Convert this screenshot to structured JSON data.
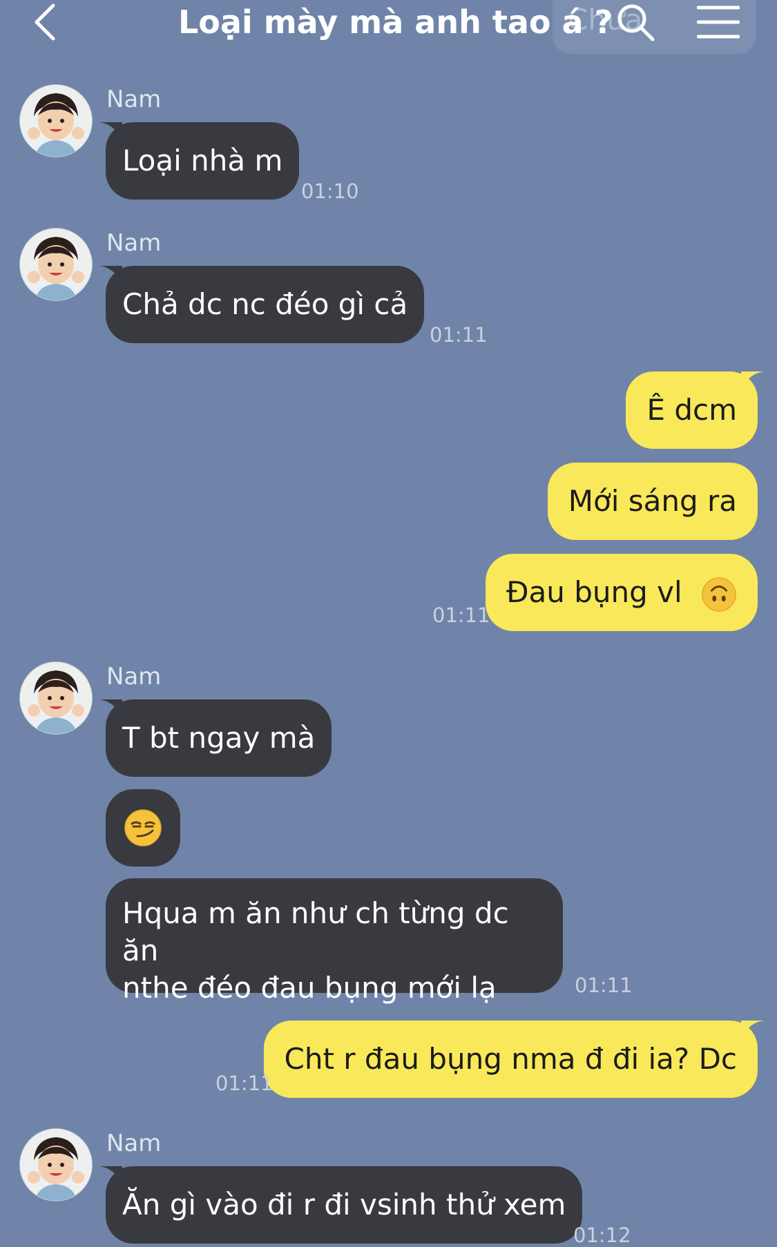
{
  "header": {
    "title": "Loại mày mà anh tao á ?",
    "ghost_text": "Chưa"
  },
  "colors": {
    "background": "#6f84a8",
    "incoming_bubble": "#393a3f",
    "outgoing_bubble": "#f9e859"
  },
  "messages": [
    {
      "sender": "Nam",
      "text": "Loại nhà m",
      "time": "01:10"
    },
    {
      "sender": "Nam",
      "text": "Chả dc nc đéo gì cả",
      "time": "01:11"
    },
    {
      "text": "Ê dcm"
    },
    {
      "text": "Mới sáng ra"
    },
    {
      "text": "Đau bụng vl",
      "emoji": "upside-down-face",
      "time": "01:11"
    },
    {
      "sender": "Nam",
      "text": "T bt ngay mà"
    },
    {
      "emoji": "smirking-face"
    },
    {
      "text_line1": "Hqua m ăn như ch từng dc ăn",
      "text_line2": "nthe đéo đau bụng mới lạ",
      "time": "01:11"
    },
    {
      "text": "Cht r đau bụng nma đ đi ia? Dc",
      "time": "01:11"
    },
    {
      "sender": "Nam",
      "text": "Ăn gì vào đi r đi vsinh thử xem",
      "time": "01:12"
    }
  ]
}
